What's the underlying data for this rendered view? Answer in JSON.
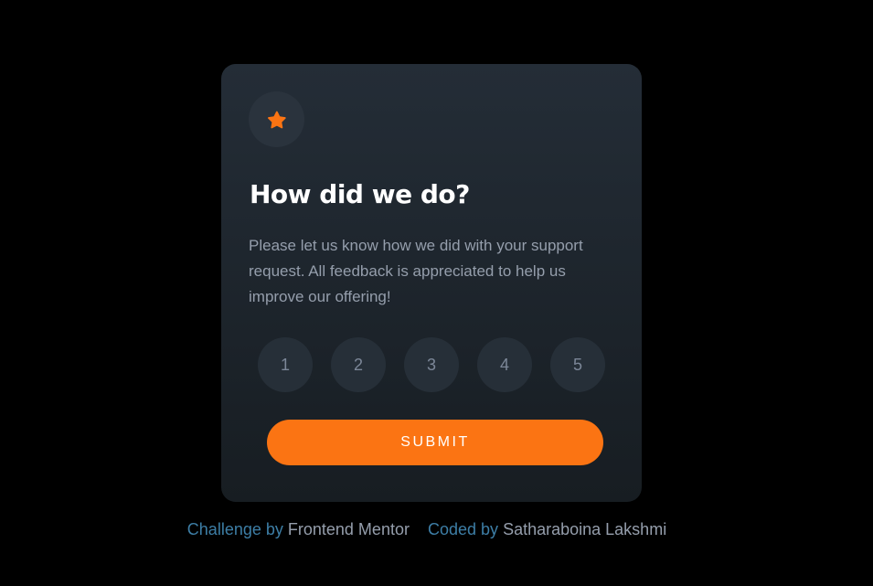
{
  "card": {
    "title": "How did we do?",
    "description": "Please let us know how we did with your support request. All feedback is appreciated to help us improve our offering!",
    "icon": "star-icon",
    "ratings": [
      "1",
      "2",
      "3",
      "4",
      "5"
    ],
    "submit_label": "SUBMIT"
  },
  "attribution": {
    "challenge_prefix": "Challenge by",
    "challenge_link": "Frontend Mentor",
    "coded_prefix": "Coded by",
    "coded_link": "Satharaboina Lakshmi"
  },
  "colors": {
    "accent": "#fb7413",
    "background": "#000000",
    "card_top": "#242d37",
    "card_bottom": "#171d22",
    "muted_text": "#959eac",
    "attribution_blue": "#3d7ea6"
  }
}
